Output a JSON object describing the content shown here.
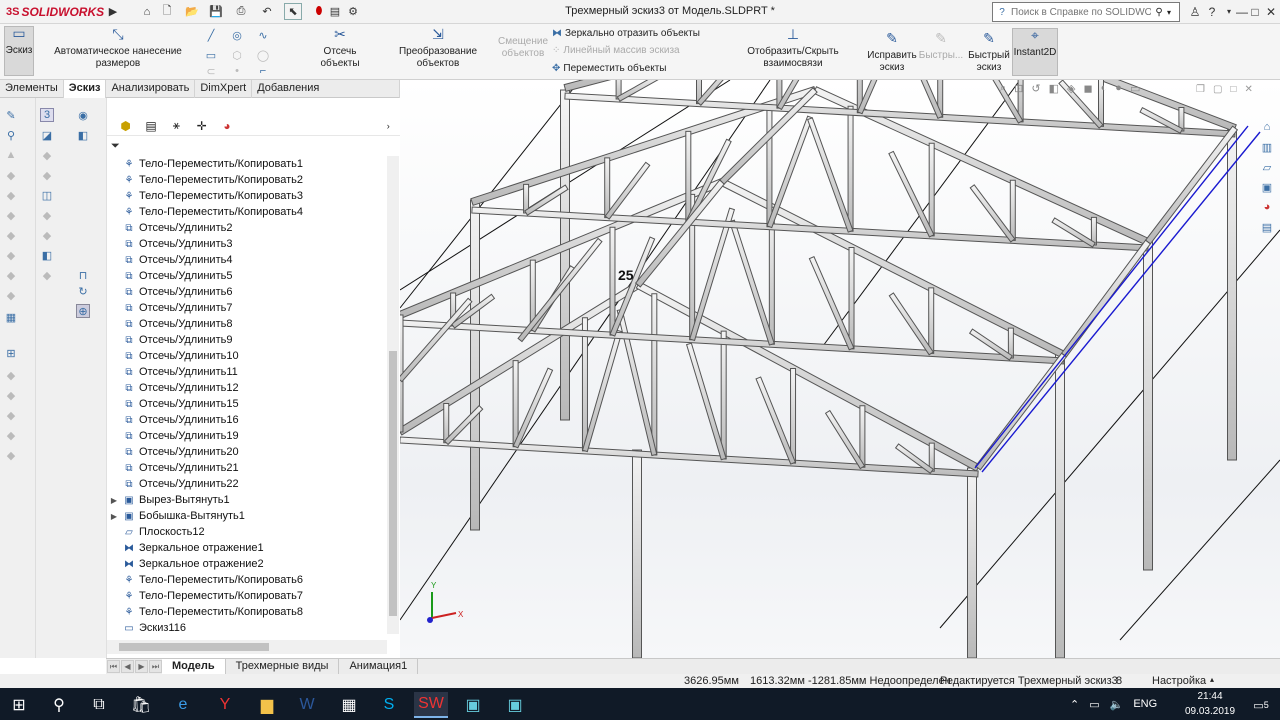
{
  "app": {
    "name": "SOLIDWORKS",
    "document_title": "Трехмерный эскиз3 от Модель.SLDPRT *"
  },
  "help": {
    "placeholder": "Поиск в Справке по SOLIDWORKS"
  },
  "window_controls": {
    "help": "?",
    "minimize": "—",
    "maximize": "□",
    "close": "✕"
  },
  "ribbon": {
    "sketch": "Эскиз",
    "auto_dims": "Автоматическое нанесение размеров",
    "trim": "Отсечь объекты",
    "convert": "Преобразование объектов",
    "offset_line1": "Смещение",
    "offset_line2": "объектов",
    "mirror": "Зеркально отразить объекты",
    "linear_pattern": "Линейный массив эскиза",
    "move": "Переместить объекты",
    "show_hide": "Отобразить/Скрыть взаимосвязи",
    "repair_line1": "Исправить",
    "repair_line2": "эскиз",
    "fast_line1": "Быстры...",
    "quick_line1": "Быстрый",
    "quick_line2": "эскиз",
    "instant2d": "Instant2D"
  },
  "tabs": [
    "Элементы",
    "Эскиз",
    "Анализировать",
    "DimXpert",
    "Добавления SOLIDWORKS"
  ],
  "active_tab": "Эскиз",
  "tree": [
    {
      "label": "Тело-Переместить/Копировать1",
      "icon": "move-copy-body-icon",
      "expand": false
    },
    {
      "label": "Тело-Переместить/Копировать2",
      "icon": "move-copy-body-icon",
      "expand": false
    },
    {
      "label": "Тело-Переместить/Копировать3",
      "icon": "move-copy-body-icon",
      "expand": false
    },
    {
      "label": "Тело-Переместить/Копировать4",
      "icon": "move-copy-body-icon",
      "expand": false
    },
    {
      "label": "Отсечь/Удлинить2",
      "icon": "trim-extend-icon",
      "expand": false
    },
    {
      "label": "Отсечь/Удлинить3",
      "icon": "trim-extend-icon",
      "expand": false
    },
    {
      "label": "Отсечь/Удлинить4",
      "icon": "trim-extend-icon",
      "expand": false
    },
    {
      "label": "Отсечь/Удлинить5",
      "icon": "trim-extend-icon",
      "expand": false
    },
    {
      "label": "Отсечь/Удлинить6",
      "icon": "trim-extend-icon",
      "expand": false
    },
    {
      "label": "Отсечь/Удлинить7",
      "icon": "trim-extend-icon",
      "expand": false
    },
    {
      "label": "Отсечь/Удлинить8",
      "icon": "trim-extend-icon",
      "expand": false
    },
    {
      "label": "Отсечь/Удлинить9",
      "icon": "trim-extend-icon",
      "expand": false
    },
    {
      "label": "Отсечь/Удлинить10",
      "icon": "trim-extend-icon",
      "expand": false
    },
    {
      "label": "Отсечь/Удлинить11",
      "icon": "trim-extend-icon",
      "expand": false
    },
    {
      "label": "Отсечь/Удлинить12",
      "icon": "trim-extend-icon",
      "expand": false
    },
    {
      "label": "Отсечь/Удлинить15",
      "icon": "trim-extend-icon",
      "expand": false
    },
    {
      "label": "Отсечь/Удлинить16",
      "icon": "trim-extend-icon",
      "expand": false
    },
    {
      "label": "Отсечь/Удлинить19",
      "icon": "trim-extend-icon",
      "expand": false
    },
    {
      "label": "Отсечь/Удлинить20",
      "icon": "trim-extend-icon",
      "expand": false
    },
    {
      "label": "Отсечь/Удлинить21",
      "icon": "trim-extend-icon",
      "expand": false
    },
    {
      "label": "Отсечь/Удлинить22",
      "icon": "trim-extend-icon",
      "expand": false
    },
    {
      "label": "Вырез-Вытянуть1",
      "icon": "cut-extrude-icon",
      "expand": true
    },
    {
      "label": "Бобышка-Вытянуть1",
      "icon": "boss-extrude-icon",
      "expand": true
    },
    {
      "label": "Плоскость12",
      "icon": "plane-icon",
      "expand": false
    },
    {
      "label": "Зеркальное отражение1",
      "icon": "mirror-icon",
      "expand": false
    },
    {
      "label": "Зеркальное отражение2",
      "icon": "mirror-icon",
      "expand": false
    },
    {
      "label": "Тело-Переместить/Копировать6",
      "icon": "move-copy-body-icon",
      "expand": false
    },
    {
      "label": "Тело-Переместить/Копировать7",
      "icon": "move-copy-body-icon",
      "expand": false
    },
    {
      "label": "Тело-Переместить/Копировать8",
      "icon": "move-copy-body-icon",
      "expand": false
    },
    {
      "label": "Эскиз116",
      "icon": "sketch-icon",
      "expand": false
    }
  ],
  "bottom_tabs": [
    "Модель",
    "Трехмерные виды",
    "Анимация1"
  ],
  "active_bottom_tab": "Модель",
  "status": {
    "length": "3626.95мм",
    "coords": "1613.32мм -1281.85мм Недоопределен",
    "editing": "Редактируется Трехмерный эскиз3",
    "units": "Настройка"
  },
  "viewport": {
    "annotation": "25",
    "axis_x": "X",
    "axis_y": "Y"
  },
  "taskbar": {
    "lang": "ENG",
    "time": "21:44",
    "date": "09.03.2019",
    "notif": "5"
  }
}
